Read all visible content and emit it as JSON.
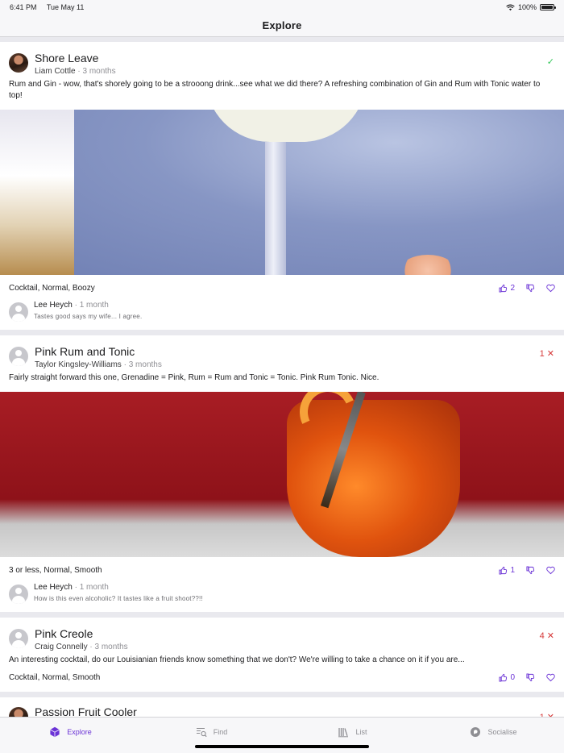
{
  "status_bar": {
    "time": "6:41 PM",
    "date": "Tue May 11",
    "battery": "100%",
    "battery_level": 1.0
  },
  "nav": {
    "title": "Explore"
  },
  "feed": {
    "cards": [
      {
        "title": "Shore Leave",
        "author": "Liam Cottle",
        "age": "3 months",
        "status_icon": "check-icon",
        "description": "Rum and Gin - wow, that's shorely going to be a strooong drink...see what we did there? A refreshing combination of Gin and Rum with Tonic water to top!",
        "tags": "Cocktail, Normal, Boozy",
        "likes": "2",
        "comment": {
          "author": "Lee Heych",
          "age": "1 month",
          "text": "Tastes good says my wife... I agree."
        }
      },
      {
        "title": "Pink Rum and Tonic",
        "author": "Taylor Kingsley-Williams",
        "age": "3 months",
        "reject_count": "1",
        "description": "Fairly straight forward this one, Grenadine = Pink, Rum = Rum and Tonic = Tonic. Pink Rum Tonic. Nice.",
        "tags": "3 or less, Normal, Smooth",
        "likes": "1",
        "comment": {
          "author": "Lee Heych",
          "age": "1 month",
          "text": "How is this even alcoholic? It tastes like a fruit shoot??!!"
        }
      },
      {
        "title": "Pink Creole",
        "author": "Craig Connelly",
        "age": "3 months",
        "reject_count": "4",
        "description": "An interesting cocktail, do our Louisianian friends know something that we don't? We're willing to take a chance on it if you are...",
        "tags": "Cocktail, Normal, Smooth",
        "likes": "0"
      },
      {
        "title": "Passion Fruit Cooler",
        "reject_count": "1"
      }
    ]
  },
  "separator": "·",
  "tabbar": {
    "tabs": [
      {
        "label": "Explore",
        "icon": "cube-icon"
      },
      {
        "label": "Find",
        "icon": "search-list-icon"
      },
      {
        "label": "List",
        "icon": "library-icon"
      },
      {
        "label": "Socialise",
        "icon": "chat-bubble-icon"
      }
    ]
  },
  "colors": {
    "accent": "#6b33d6",
    "reject": "#d63a3a",
    "approve": "#34c759"
  }
}
